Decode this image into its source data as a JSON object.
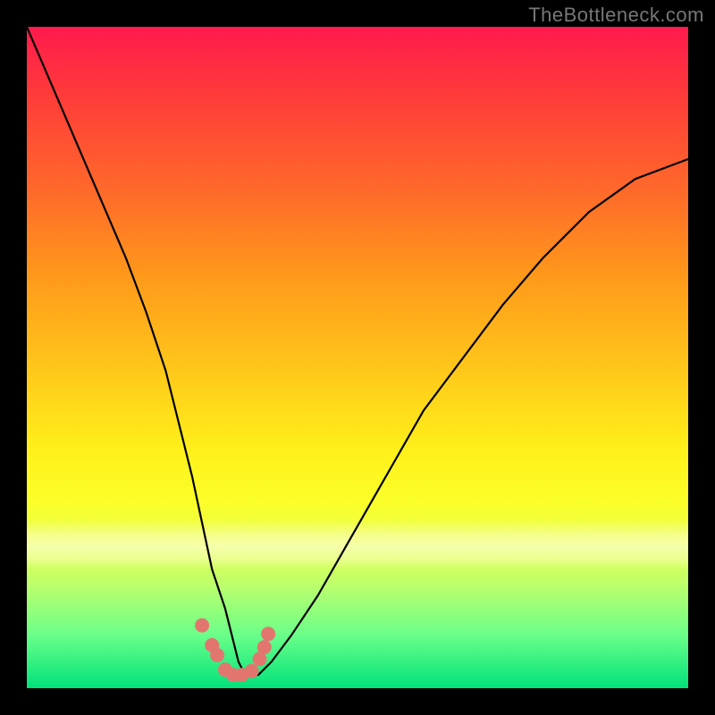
{
  "watermark": "TheBottleneck.com",
  "chart_data": {
    "type": "line",
    "title": "",
    "xlabel": "",
    "ylabel": "",
    "xlim": [
      0,
      100
    ],
    "ylim": [
      0,
      100
    ],
    "grid": false,
    "legend": false,
    "series": [
      {
        "name": "curve",
        "x": [
          0,
          3,
          6,
          9,
          12,
          15,
          18,
          21,
          23,
          25,
          26.5,
          28,
          30,
          31,
          32,
          33,
          35,
          37,
          40,
          44,
          48,
          52,
          56,
          60,
          66,
          72,
          78,
          85,
          92,
          100
        ],
        "y": [
          100,
          93,
          86,
          79,
          72,
          65,
          57,
          48,
          40,
          32,
          25,
          18,
          12,
          8,
          4,
          2,
          2,
          4,
          8,
          14,
          21,
          28,
          35,
          42,
          50,
          58,
          65,
          72,
          77,
          80
        ]
      },
      {
        "name": "dots",
        "type": "scatter",
        "x": [
          26.5,
          28.0,
          28.8,
          30.0,
          31.2,
          32.5,
          34.0,
          35.2,
          35.9,
          36.5
        ],
        "y": [
          9.5,
          6.5,
          5.0,
          2.8,
          2.0,
          2.0,
          2.6,
          4.4,
          6.2,
          8.2
        ]
      }
    ],
    "colors": {
      "curve": "#000000",
      "dots": "#e2766f",
      "gradient_top": "#ff1a4d",
      "gradient_bottom": "#00e27a"
    }
  }
}
